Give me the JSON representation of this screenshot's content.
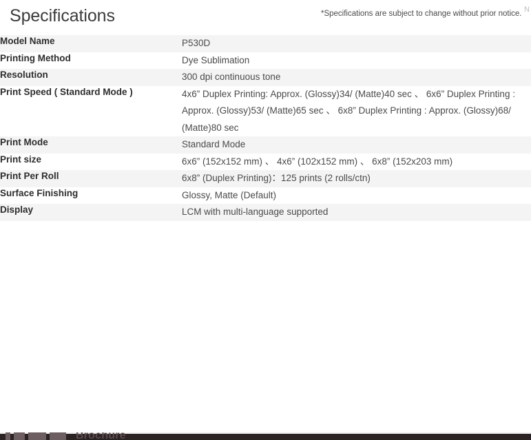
{
  "header": {
    "title": "Specifications",
    "notice": "*Specifications are subject to change without prior notice.",
    "edge_clip": "N"
  },
  "table": {
    "rows": [
      {
        "label": "Model Name",
        "value": "P530D",
        "shaded": true,
        "wrap": false
      },
      {
        "label": "Printing Method",
        "value": "Dye Sublimation",
        "shaded": false,
        "wrap": false
      },
      {
        "label": "Resolution",
        "value": "300 dpi continuous tone",
        "shaded": true,
        "wrap": false
      },
      {
        "label": "Print Speed ( Standard Mode )",
        "value": "4x6” Duplex Printing: Approx. (Glossy)34/ (Matte)40 sec 、 6x6” Duplex Printing : Approx. (Glossy)53/ (Matte)65 sec 、 6x8” Duplex Printing : Approx. (Glossy)68/ (Matte)80 sec",
        "shaded": false,
        "wrap": true
      },
      {
        "label": "Print Mode",
        "value": "Standard Mode",
        "shaded": true,
        "wrap": false
      },
      {
        "label": "Print size",
        "value": "6x6” (152x152 mm) 、 4x6” (102x152 mm) 、 6x8” (152x203 mm)",
        "shaded": false,
        "wrap": false
      },
      {
        "label": "Print Per Roll",
        "value": "6x8” (Duplex Printing)：125 prints (2 rolls/ctn)",
        "shaded": true,
        "wrap": false
      },
      {
        "label": "Surface Finishing",
        "value": "Glossy, Matte (Default)",
        "shaded": false,
        "wrap": false
      },
      {
        "label": "Display",
        "value": "LCM with multi-language supported",
        "shaded": true,
        "wrap": false
      }
    ]
  },
  "bottom_section": {
    "label": "Brochure"
  },
  "colors": {
    "shaded_row": "#f4f4f4",
    "plain_row": "#ffffff",
    "label_text": "#2d2d2d",
    "value_text": "#4a4a4a",
    "title_text": "#3b3b3b",
    "bottom_strip": "#2b2324"
  }
}
